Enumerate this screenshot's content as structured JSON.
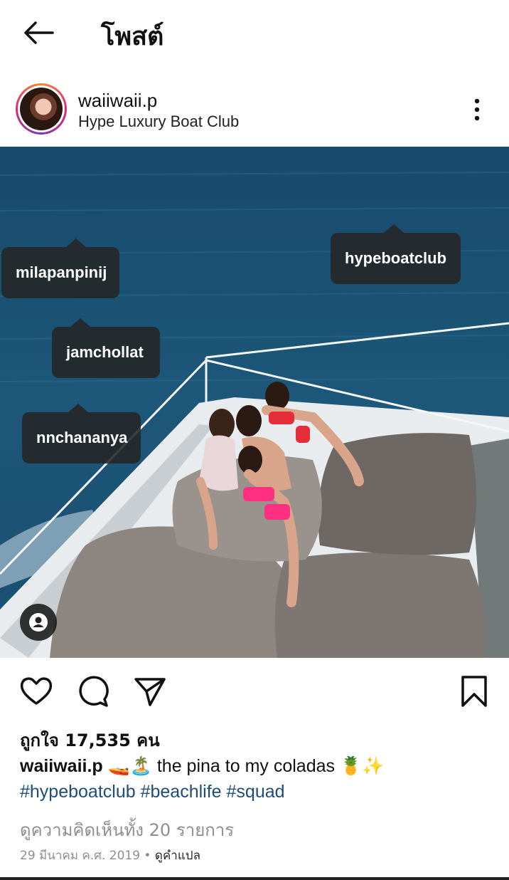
{
  "header": {
    "title": "โพสต์",
    "back_icon": "arrow-left-icon"
  },
  "post": {
    "username": "waiiwaii.p",
    "location": "Hype Luxury Boat Club",
    "more_icon": "more-vertical-icon"
  },
  "photo": {
    "tags": [
      "milapanpinij",
      "hypeboatclub",
      "jamchollat",
      "nnchananya"
    ],
    "user_tags_icon": "person-icon"
  },
  "actions": {
    "like_icon": "heart-icon",
    "comment_icon": "comment-icon",
    "share_icon": "paper-plane-icon",
    "save_icon": "bookmark-icon"
  },
  "likes": "ถูกใจ 17,535 คน",
  "caption": {
    "username": "waiiwaii.p",
    "text": "🚤🏝️ the pina to my coladas 🍍✨",
    "hashtags": [
      "#hypeboatclub",
      "#beachlife",
      "#squad"
    ]
  },
  "view_comments": "ดูความคิดเห็นทั้ง 20 รายการ",
  "meta": {
    "date": "29 มีนาคม ค.ศ. 2019",
    "separator": " • ",
    "translate": "ดูคำแปล"
  },
  "colors": {
    "hashtag": "#1f4c7a",
    "muted": "#8e8e8e",
    "tag_bg": "#262626"
  }
}
